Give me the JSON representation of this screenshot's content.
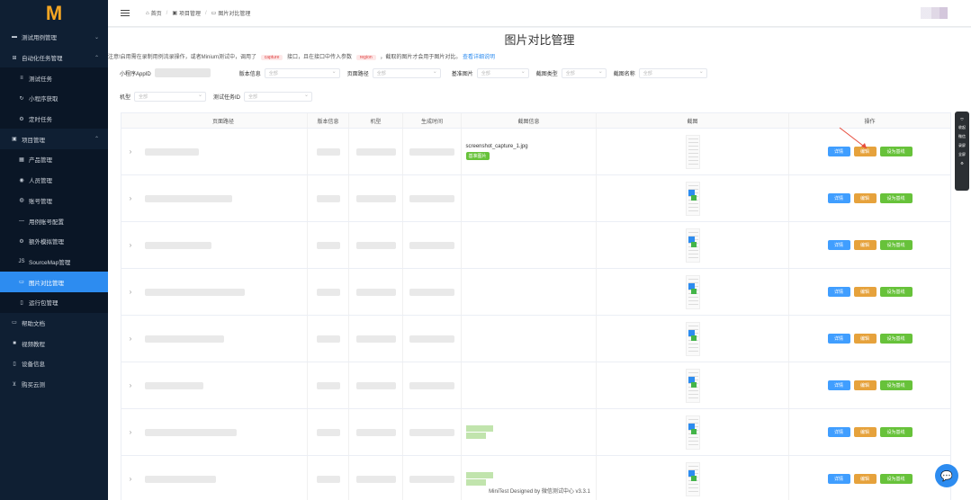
{
  "logo": "M",
  "sidebar": {
    "items": [
      {
        "label": "测试用例管理",
        "icon": "folder-icon",
        "chevron": "⌄"
      },
      {
        "label": "自动化任务管理",
        "icon": "robot-icon",
        "chevron": "⌃"
      },
      {
        "label": "测试任务",
        "icon": "list-icon",
        "sub": true
      },
      {
        "label": "小程序获取",
        "icon": "refresh-icon",
        "sub": true
      },
      {
        "label": "定时任务",
        "icon": "gear-icon",
        "sub": true
      },
      {
        "label": "项目管理",
        "icon": "briefcase-icon",
        "chevron": "⌃"
      },
      {
        "label": "产品管理",
        "icon": "table-icon",
        "sub": true
      },
      {
        "label": "人员管理",
        "icon": "user-icon",
        "sub": true
      },
      {
        "label": "账号管理",
        "icon": "account-icon",
        "sub": true
      },
      {
        "label": "用例账号配置",
        "icon": "dash-icon",
        "sub": true
      },
      {
        "label": "额外模拟管理",
        "icon": "settings-icon",
        "sub": true
      },
      {
        "label": "SourceMap管理",
        "icon": "js-icon",
        "sub": true
      },
      {
        "label": "图片对比管理",
        "icon": "image-icon",
        "sub": true,
        "active": true
      },
      {
        "label": "运行包管理",
        "icon": "phone-icon",
        "sub": true
      },
      {
        "label": "帮助文档",
        "icon": "book-icon"
      },
      {
        "label": "视频教程",
        "icon": "video-icon"
      },
      {
        "label": "设备信息",
        "icon": "device-icon"
      },
      {
        "label": "购买云测",
        "icon": "cart-icon"
      }
    ]
  },
  "breadcrumb": [
    "首页",
    "项目管理",
    "图片对比管理"
  ],
  "page_title": "图片对比管理",
  "note": {
    "before": "注意!启用需在录制用例流录操作，或者Minium测试中，调用了",
    "tag1": "capture",
    "mid1": "接口，且在接口中传入参数",
    "tag2": "region",
    "mid2": "，截取的图片才会用于图片对比。",
    "link": "查看详细说明"
  },
  "filters": {
    "appid_label": "小程序AppID",
    "version_label": "版本信息",
    "version_value": "全部",
    "page_label": "页面路径",
    "page_value": "全部",
    "baseline_label": "基准图片",
    "baseline_value": "全部",
    "shot_type_label": "截图类型",
    "shot_type_value": "全部",
    "shot_name_label": "截图名称",
    "shot_name_value": "全部",
    "model_label": "机型",
    "model_value": "全部",
    "taskid_label": "测试任务ID",
    "taskid_value": "全部"
  },
  "table": {
    "headers": [
      "页面路径",
      "版本信息",
      "机型",
      "生成时间",
      "截图信息",
      "截图",
      "操作"
    ],
    "file_name": "screenshot_capture_1.jpg",
    "baseline_badge": "基准图片",
    "buttons": {
      "detail": "详情",
      "edit": "编辑",
      "base": "设为基线"
    }
  },
  "footer": "MiniTest Designed by 微信测试中心 v3.3.1",
  "float_toolbar": [
    "收起",
    "微信",
    "录屏",
    "全屏"
  ]
}
